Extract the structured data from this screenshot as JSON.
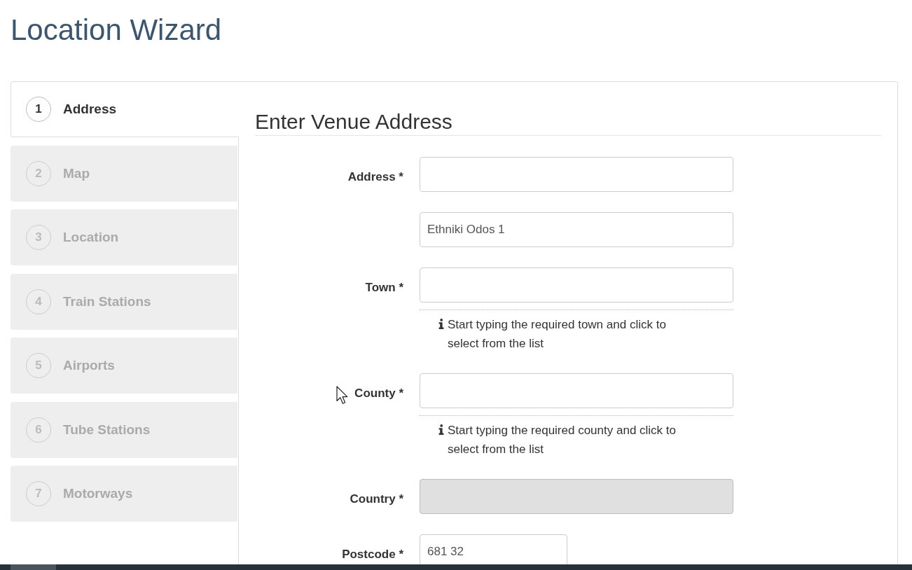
{
  "page": {
    "title": "Location Wizard"
  },
  "steps": [
    {
      "number": "1",
      "label": "Address",
      "selected": true
    },
    {
      "number": "2",
      "label": "Map",
      "selected": false
    },
    {
      "number": "3",
      "label": "Location",
      "selected": false
    },
    {
      "number": "4",
      "label": "Train Stations",
      "selected": false
    },
    {
      "number": "5",
      "label": "Airports",
      "selected": false
    },
    {
      "number": "6",
      "label": "Tube Stations",
      "selected": false
    },
    {
      "number": "7",
      "label": "Motorways",
      "selected": false
    }
  ],
  "form": {
    "heading": "Enter Venue Address",
    "fields": [
      {
        "label": "Address *",
        "kind": "full",
        "disabled": false
      },
      {
        "value": "Ethniki Odos 1",
        "kind": "full",
        "disabled": false
      },
      {
        "label": "Town *",
        "kind": "full",
        "disabled": false,
        "help": "Start typing the required town and click to select from the list"
      },
      {
        "label": "County *",
        "kind": "full",
        "disabled": false,
        "help": "Start typing the required county and click to select from the list"
      },
      {
        "label": "Country *",
        "kind": "full",
        "disabled": true
      },
      {
        "label": "Postcode *",
        "value": "681 32",
        "kind": "short",
        "disabled": false
      }
    ]
  }
}
